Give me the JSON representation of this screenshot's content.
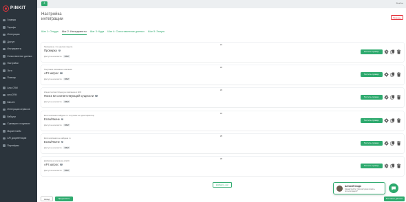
{
  "app": {
    "logo_text": "PINKIT"
  },
  "sidebar": {
    "items": [
      {
        "label": "Главная",
        "icon": "home-icon"
      },
      {
        "label": "Тарифы",
        "icon": "tag-icon"
      },
      {
        "label": "Интеграции",
        "icon": "plug-icon"
      },
      {
        "label": "Доступ",
        "icon": "key-icon"
      },
      {
        "label": "Инструменты",
        "icon": "wrench-icon"
      },
      {
        "label": "Сопоставление данных",
        "icon": "link-icon"
      },
      {
        "label": "Настройки",
        "icon": "gear-icon"
      },
      {
        "label": "Логи",
        "icon": "list-icon"
      },
      {
        "label": "Помощь",
        "icon": "help-icon"
      },
      {
        "label": "Amo CRM",
        "icon": "crm-icon"
      },
      {
        "label": "amoCRM",
        "icon": "crm-icon"
      },
      {
        "label": "Bitrix24",
        "icon": "crm-icon"
      },
      {
        "label": "Интеграции сервисов",
        "icon": "plug-icon"
      },
      {
        "label": "Вебхуки",
        "icon": "webhook-icon"
      },
      {
        "label": "Сценарии и подписки",
        "icon": "flow-icon"
      },
      {
        "label": "Маркетплейс",
        "icon": "store-icon"
      },
      {
        "label": "API документация",
        "icon": "doc-icon"
      },
      {
        "label": "Партнёрам",
        "icon": "users-icon"
      }
    ]
  },
  "topbar": {
    "button_icon": "plus-icon",
    "user_label": "Выйти"
  },
  "page": {
    "title_line1": "Настройка",
    "title_line2": "интеграции",
    "help_label": "Помощь"
  },
  "steps": [
    {
      "label": "Шаг 1: Откуда"
    },
    {
      "label": "Шаг 2: Инструменты"
    },
    {
      "label": "Шаг 3: Куда"
    },
    {
      "label": "Шаг 4: Сопоставление данных"
    },
    {
      "label": "Шаг 5: Запуск"
    }
  ],
  "cards": [
    {
      "number": "#1",
      "desc": "Проверяем, что сделка открыта",
      "name": "Проверка",
      "access": "Доступ на контекста:",
      "badge": "ФБЕТ"
    },
    {
      "number": "#2",
      "desc": "Получаем связанные компании",
      "name": "API запрос",
      "access": "Доступ на контекста:",
      "badge": "ФБЕТ"
    },
    {
      "number": "#3",
      "desc": "Ищем соответствующую компанию в ЕСК",
      "name": "Поиск ID соответствующей сущности",
      "access": "Доступ на контекста:",
      "badge": "ФБЕТ"
    },
    {
      "number": "#4",
      "desc": "Если компания найдена то получаем ее идентификатор",
      "name": "Если/Иначе",
      "access": "Доступ на контекста:",
      "badge": "ФБЕТ"
    },
    {
      "number": "#5",
      "desc": "Если компания не найдена то",
      "name": "Если/Иначе",
      "access": "Доступ на контекста:",
      "badge": "ФБЕТ"
    },
    {
      "number": "#6",
      "desc": "Добавляем компанию в ЕСК",
      "name": "API запрос",
      "access": "Доступ на контекста:",
      "badge": "ФБЕТ"
    }
  ],
  "card_actions": {
    "check_label": "Тестить провер.",
    "icons": [
      "gear-icon",
      "copy-icon",
      "trash-icon"
    ]
  },
  "add_label": "Добавить шаг",
  "footer": {
    "back_label": "Назад",
    "next_label": "Продолжить",
    "test_label": "Тестовые данные"
  },
  "chat": {
    "name": "Алексей Осадо",
    "message": "Здравствуйте! Чем могу вам помочь по интеграции?",
    "fab_icon": "chat-icon"
  },
  "colors": {
    "accent": "#2eaa6e",
    "brand": "#e5343d",
    "sidebar": "#2b343c"
  }
}
